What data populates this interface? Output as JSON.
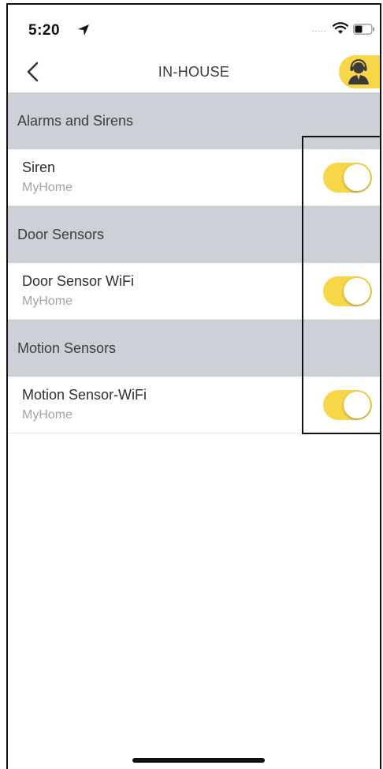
{
  "status_bar": {
    "time": "5:20",
    "signal_dots": "....."
  },
  "nav": {
    "title": "IN-HOUSE"
  },
  "colors": {
    "accent": "#f7d648",
    "section_bg": "#cdd0d6"
  },
  "icons": {
    "back": "chevron-left-icon",
    "agent": "support-agent-icon",
    "location": "location-arrow-icon",
    "wifi": "wifi-icon",
    "battery": "battery-icon"
  },
  "sections": [
    {
      "header": "Alarms and Sirens",
      "items": [
        {
          "title": "Siren",
          "subtitle": "MyHome",
          "enabled": true
        }
      ]
    },
    {
      "header": "Door Sensors",
      "items": [
        {
          "title": "Door Sensor WiFi",
          "subtitle": "MyHome",
          "enabled": true
        }
      ]
    },
    {
      "header": "Motion Sensors",
      "items": [
        {
          "title": "Motion Sensor-WiFi",
          "subtitle": "MyHome",
          "enabled": true
        }
      ]
    }
  ]
}
